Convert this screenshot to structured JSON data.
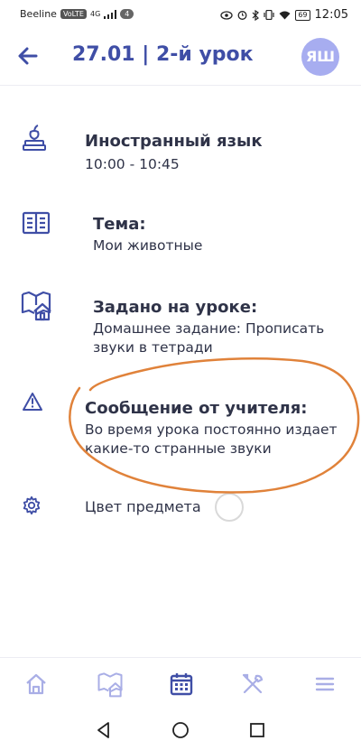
{
  "status_bar": {
    "carrier": "Beeline",
    "volte": "VoLTE",
    "network": "4G",
    "notif_count": "4",
    "battery": "69",
    "time": "12:05"
  },
  "header": {
    "back_icon": "arrow-left-icon",
    "title": "27.01 | 2-й урок",
    "avatar_initials": "ЯШ"
  },
  "lesson": {
    "subject": {
      "icon": "books-apple-icon",
      "name": "Иностранный язык",
      "time": "10:00 - 10:45"
    },
    "topic": {
      "icon": "open-book-icon",
      "label": "Тема:",
      "value": "Мои животные"
    },
    "homework": {
      "icon": "book-house-icon",
      "label": "Задано на уроке:",
      "value": "Домашнее задание: Прописать звуки в тетради"
    },
    "message": {
      "icon": "warning-icon",
      "label": "Сообщение от учителя:",
      "value": "Во время урока постоянно издает какие-то странные звуки"
    },
    "color": {
      "icon": "gear-icon",
      "label": "Цвет предмета"
    }
  },
  "colors": {
    "accent": "#3f4ea6",
    "annotation": "#e0823a",
    "avatar": "#a7adf0"
  },
  "tab_bar": [
    {
      "icon": "home-icon",
      "active": false
    },
    {
      "icon": "book-house-icon",
      "active": false
    },
    {
      "icon": "calendar-icon",
      "active": true
    },
    {
      "icon": "tools-icon",
      "active": false
    },
    {
      "icon": "menu-icon",
      "active": false
    }
  ],
  "system_nav": [
    "back-triangle-icon",
    "home-circle-icon",
    "recents-square-icon"
  ]
}
